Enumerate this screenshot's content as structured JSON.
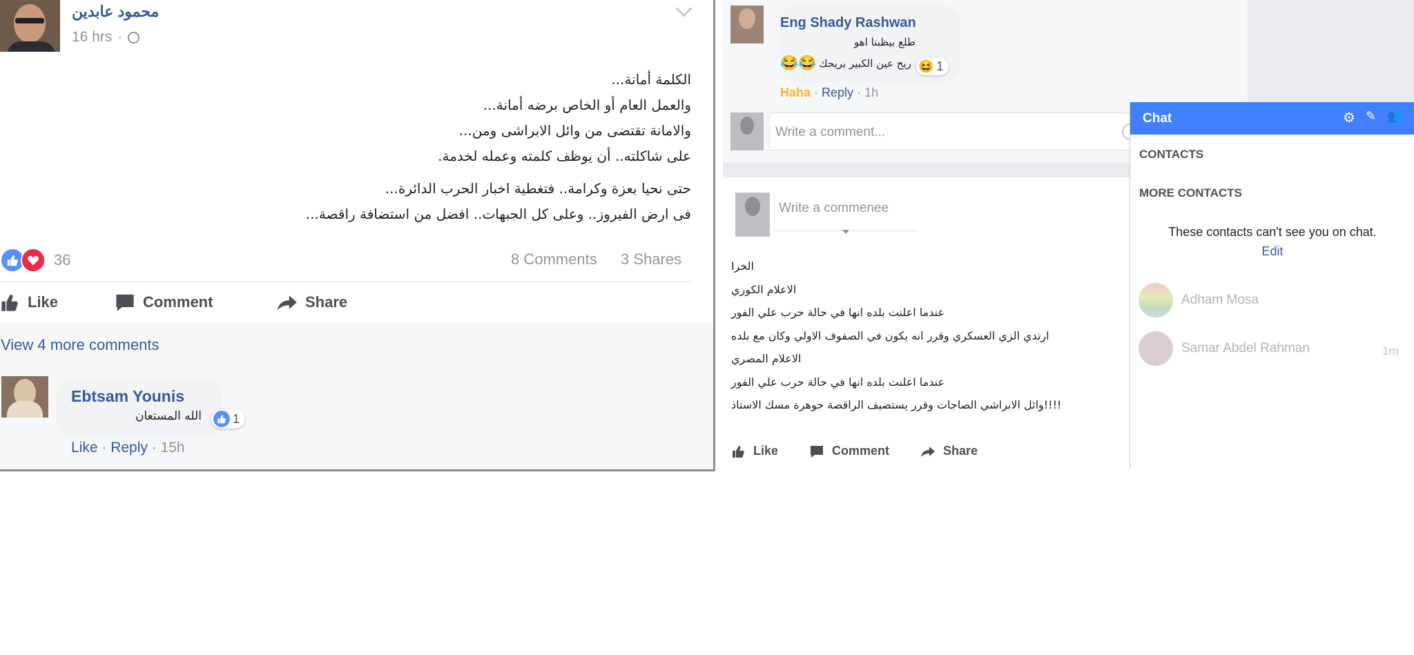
{
  "left_post": {
    "author": "محمود عابدين",
    "time": "16 hrs",
    "text_lines": [
      "الكلمة أمانة...",
      "والعمل العام أو الخاص برضه أمانة...",
      "والامانة تقتضى من وائل الابراشى ومن...",
      "على شاكلته.. أن يوظف كلمته وعمله لخدمة.",
      "حتى نحيا بعزة وكرامة.. فتغطية اخبار الحرب الدائرة...",
      "فى ارض الفيروز.. وعلى كل الجبهات.. افضل من استضافة راقصة..."
    ],
    "reaction_count": "36",
    "comments_count": "8 Comments",
    "shares_count": "3 Shares",
    "actions": {
      "like": "Like",
      "comment": "Comment",
      "share": "Share"
    },
    "view_more": "View 4 more comments",
    "comment": {
      "author": "Ebtsam Younis",
      "text": "الله المستعان",
      "reaction_count": "1",
      "like": "Like",
      "reply": "Reply",
      "time": "15h"
    }
  },
  "right_post": {
    "top_comment": {
      "author": "Eng Shady Rashwan",
      "line1": "طلع بيظبنا اهو",
      "line2": "ريح عين الكبير بريحك",
      "reaction_count": "1",
      "reaction_label": "Haha",
      "reply": "Reply",
      "time": "1h"
    },
    "write_placeholder": "Write a comment...",
    "write_placeholder2": "Write a commenee",
    "text_lines": [
      "الخرا",
      "الاعلام الكوري",
      "عندما اعلنت بلده انها في حالة حرب علي الفور",
      "ارتدي الزي العسكري وقرر انه يكون في الصفوف الاولي وكان مع بلده",
      "الاعلام المصري",
      "عندما اعلنت بلده انها في حالة حرب علي الفور",
      "!!!!وائل الابراشي الصاجات وقرر يستضيف الراقصة جوهرة مسك الاستاذ"
    ],
    "actions": {
      "like": "Like",
      "comment": "Comment",
      "share": "Share"
    }
  },
  "chat": {
    "title": "Chat",
    "contacts_header": "CONTACTS",
    "more_contacts_header": "MORE CONTACTS",
    "notice": "These contacts can't see you on chat.",
    "edit": "Edit",
    "people": [
      {
        "name": "Adham Mosa",
        "time": ""
      },
      {
        "name": "Samar Abdel Rahman",
        "time": "1m"
      }
    ],
    "colors": {
      "header": "#4080ff"
    }
  }
}
